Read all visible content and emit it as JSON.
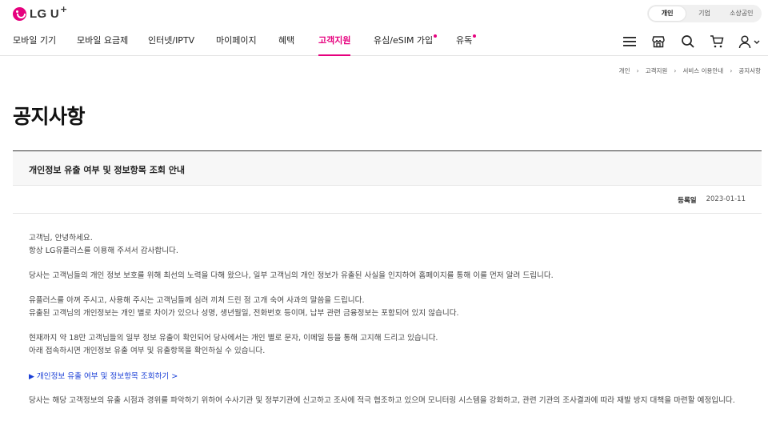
{
  "brand": {
    "name": "LG U",
    "plus": "+"
  },
  "segment": {
    "items": [
      "개인",
      "기업",
      "소상공인"
    ],
    "active": 0
  },
  "nav": {
    "items": [
      {
        "label": "모바일 기기"
      },
      {
        "label": "모바일 요금제"
      },
      {
        "label": "인터넷/IPTV"
      },
      {
        "label": "마이페이지"
      },
      {
        "label": "혜택"
      },
      {
        "label": "고객지원"
      },
      {
        "label": "유심/eSIM 가입"
      },
      {
        "label": "유독"
      }
    ],
    "active": "고객지원"
  },
  "utility_icons": [
    "menu-icon",
    "store-icon",
    "search-icon",
    "cart-icon",
    "user-icon"
  ],
  "breadcrumb": [
    "개인",
    "고객지원",
    "서비스 이용안내",
    "공지사항"
  ],
  "page": {
    "title": "공지사항"
  },
  "notice": {
    "title": "개인정보 유출 여부 및 정보항목 조회 안내",
    "date_label": "등록일",
    "date": "2023-01-11"
  },
  "content": {
    "p1": "고객님, 안녕하세요.",
    "p2": "항상 LG유플러스를 이용해 주셔서 감사합니다.",
    "p3": "당사는 고객님들의 개인 정보 보호를 위해 최선의 노력을 다해 왔으나, 일부 고객님의 개인 정보가 유출된 사실을 인지하여 홈페이지를 통해 이를 먼저 알려 드립니다.",
    "p4": "유플러스를 아껴 주시고, 사용해 주시는 고객님들께 심려 끼쳐 드린 점 고개 숙여 사과의 말씀을 드립니다.",
    "p5": "유출된 고객님의 개인정보는 개인 별로 차이가 있으나 성명, 생년월일, 전화번호 등이며, 납부 관련 금융정보는 포함되어 있지 않습니다.",
    "p6": "현재까지 약 18만 고객님들의 일부 정보 유출이 확인되어 당사에서는 개인 별로 문자, 이메일 등을 통해 고지해 드리고 있습니다.",
    "p7": "아래 접속하시면 개인정보 유출 여부 및 유출항목을 확인하실 수 있습니다.",
    "link": "개인정보 유출 여부 및 정보항목 조회하기 >",
    "p8": "당사는 해당 고객정보의 유출 시점과 경위를 파악하기 위하여 수사기관 및 정부기관에 신고하고 조사에 적극 협조하고 있으며 모니터링 시스템을 강화하고, 관련 기관의 조사결과에 따라 재발 방지 대책을 마련할 예정입니다."
  },
  "colors": {
    "accent": "#e6007e",
    "link": "#1a3fd6"
  }
}
